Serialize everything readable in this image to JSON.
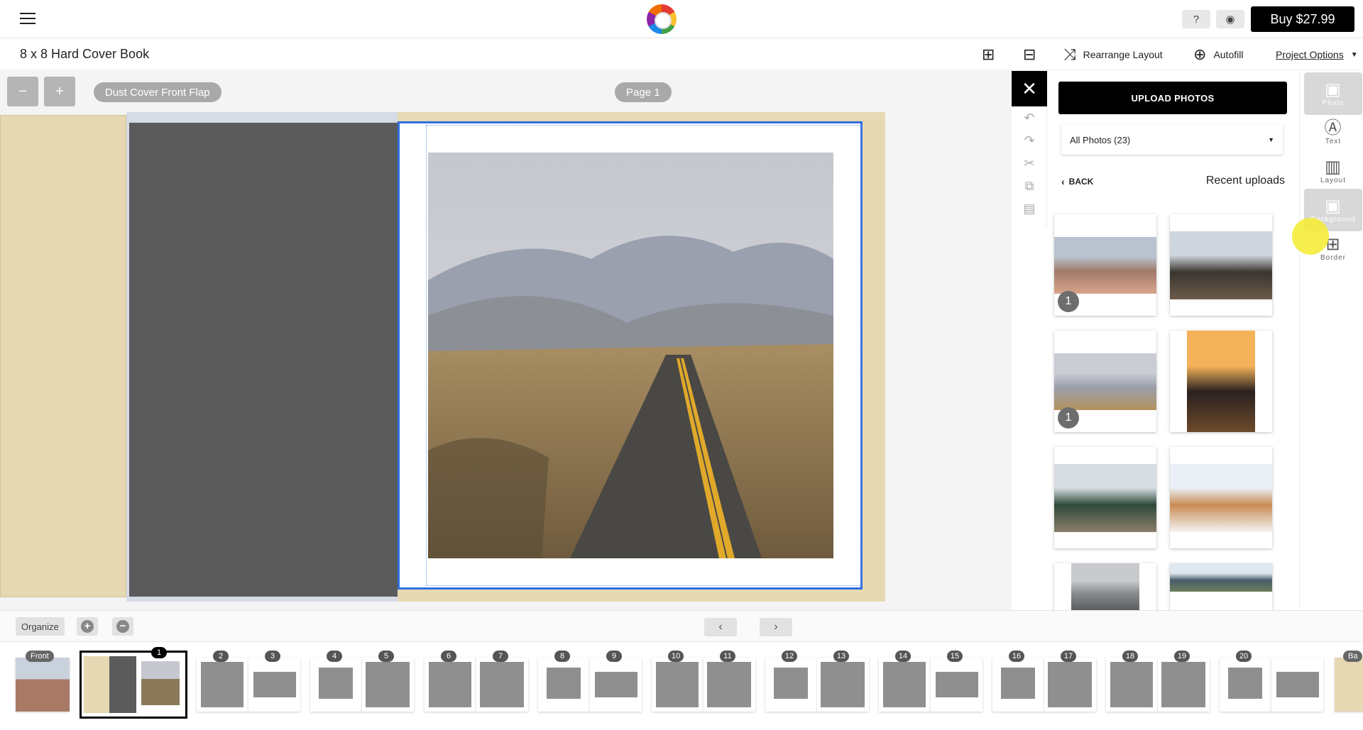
{
  "header": {
    "buy_label": "Buy $27.99"
  },
  "project": {
    "title": "8 x 8 Hard Cover Book"
  },
  "toolbar": {
    "rearrange_label": "Rearrange Layout",
    "autofill_label": "Autofill",
    "project_options_label": "Project Options"
  },
  "canvas": {
    "left_pill": "Dust Cover Front Flap",
    "page_pill": "Page 1"
  },
  "photo_panel": {
    "upload_label": "UPLOAD PHOTOS",
    "filter_value": "All Photos (23)",
    "back_label": "BACK",
    "section_title": "Recent uploads",
    "thumbs": [
      {
        "badge": "1",
        "colors": [
          "#b9c3d0",
          "#a07a6a",
          "#d9a48b"
        ]
      },
      {
        "badge": "",
        "colors": [
          "#cfd6de",
          "#3a3530",
          "#6c5a4a"
        ]
      },
      {
        "badge": "1",
        "colors": [
          "#c9ccd3",
          "#9a9fab",
          "#b4915e"
        ]
      },
      {
        "badge": "",
        "colors": [
          "#f4b35a",
          "#2a2120",
          "#6d4a2a"
        ]
      },
      {
        "badge": "",
        "colors": [
          "#d7dde3",
          "#2f4a3a",
          "#8a7e6a"
        ]
      },
      {
        "badge": "",
        "colors": [
          "#eaf0f5",
          "#c98c54",
          "#f3f3f3"
        ]
      },
      {
        "badge": "",
        "colors": [
          "#c8cacd",
          "#8a8c90",
          "#555"
        ]
      },
      {
        "badge": "",
        "colors": [
          "#dfe8ef",
          "#4a5d6a",
          "#6b7d5a"
        ]
      }
    ]
  },
  "sidebar": {
    "items": [
      {
        "label": "Photo",
        "icon": "photo-icon"
      },
      {
        "label": "Text",
        "icon": "text-icon"
      },
      {
        "label": "Layout",
        "icon": "layout-icon"
      },
      {
        "label": "Background",
        "icon": "background-icon"
      },
      {
        "label": "Border",
        "icon": "border-icon"
      }
    ]
  },
  "bottom": {
    "organize_label": "Organize",
    "front_label": "Front",
    "back_label_partial": "Ba",
    "page_numbers": [
      "1",
      "2",
      "3",
      "4",
      "5",
      "6",
      "7",
      "8",
      "9",
      "10",
      "11",
      "12",
      "13",
      "14",
      "15",
      "16",
      "17",
      "18",
      "19",
      "20"
    ]
  }
}
